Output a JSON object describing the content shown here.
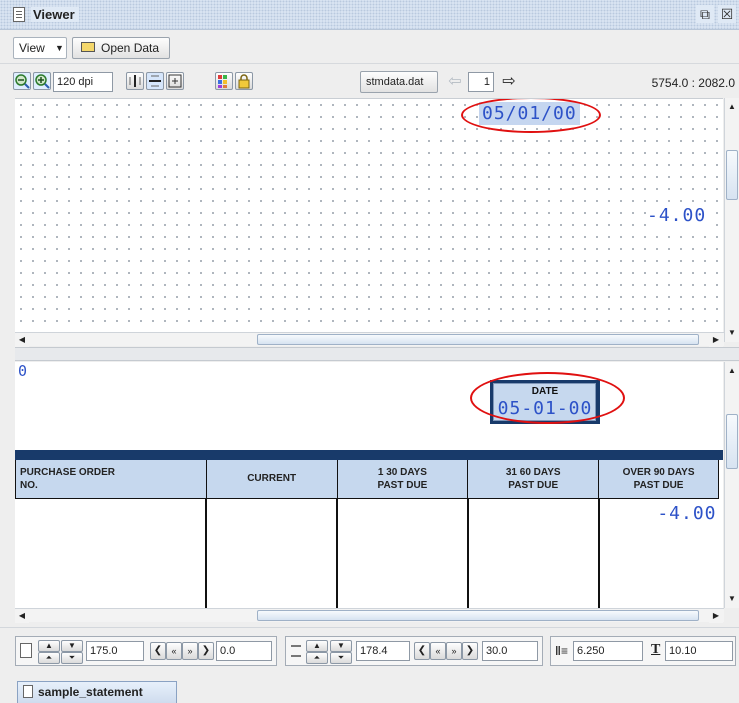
{
  "window": {
    "title": "Viewer"
  },
  "menu": {
    "view_label": "View",
    "open_data_label": "Open Data"
  },
  "toolbar": {
    "dpi_value": "120 dpi",
    "data_file": "stmdata.dat",
    "page_number": "1",
    "coordinates": "5754.0 : 2082.0"
  },
  "top_pane": {
    "date_value": "05/01/00",
    "amount_value": "-4.00"
  },
  "bottom_pane": {
    "left_value": "0",
    "date_label": "DATE",
    "date_value": "05-01-00",
    "columns": [
      "PURCHASE  ORDER\nNO.",
      "CURRENT",
      "1 30 DAYS\nPAST DUE",
      "31 60 DAYS\nPAST DUE",
      "OVER 90 DAYS\nPAST DUE"
    ],
    "amount_value": "-4.00"
  },
  "status": {
    "h_position": "175.0",
    "h_offset": "0.0",
    "v_position": "178.4",
    "v_offset": "30.0",
    "line_spacing": "6.250",
    "font_size": "10.10"
  },
  "tabs": [
    {
      "label": "sample_statement"
    }
  ],
  "colors": {
    "accent_blue": "#2d52c8",
    "highlight_fill": "#c5d6f0",
    "annotation_red": "#e01010",
    "header_fill": "#c6d8ee",
    "header_bar": "#183a6a"
  }
}
